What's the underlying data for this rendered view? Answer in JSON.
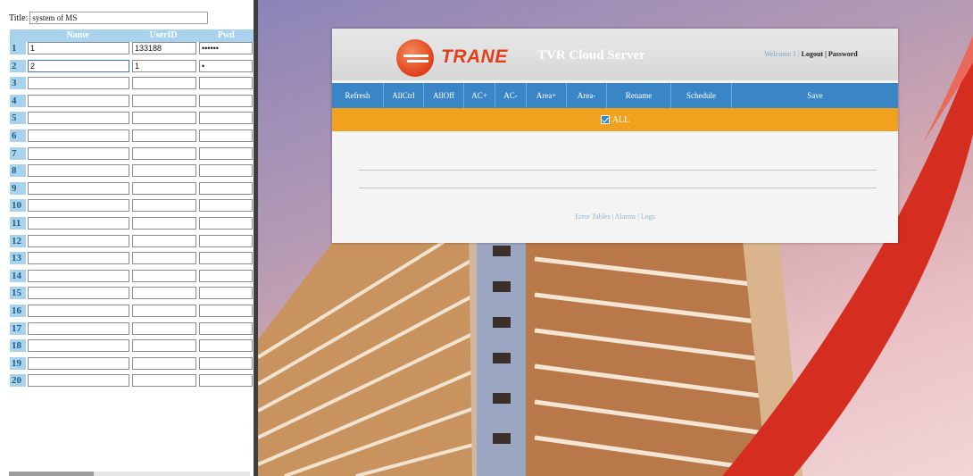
{
  "left": {
    "title_label": "Title:",
    "title_value": "system of MS",
    "headers": {
      "name": "Name",
      "userid": "UserID",
      "pwd": "Pwd"
    },
    "rows": [
      {
        "num": "1",
        "name": "1",
        "userid": "133188",
        "pwd": "••••••"
      },
      {
        "num": "2",
        "name": "2",
        "userid": "1",
        "pwd": "•"
      },
      {
        "num": "3",
        "name": "",
        "userid": "",
        "pwd": ""
      },
      {
        "num": "4",
        "name": "",
        "userid": "",
        "pwd": ""
      },
      {
        "num": "5",
        "name": "",
        "userid": "",
        "pwd": ""
      },
      {
        "num": "6",
        "name": "",
        "userid": "",
        "pwd": ""
      },
      {
        "num": "7",
        "name": "",
        "userid": "",
        "pwd": ""
      },
      {
        "num": "8",
        "name": "",
        "userid": "",
        "pwd": ""
      },
      {
        "num": "9",
        "name": "",
        "userid": "",
        "pwd": ""
      },
      {
        "num": "10",
        "name": "",
        "userid": "",
        "pwd": ""
      },
      {
        "num": "11",
        "name": "",
        "userid": "",
        "pwd": ""
      },
      {
        "num": "12",
        "name": "",
        "userid": "",
        "pwd": ""
      },
      {
        "num": "13",
        "name": "",
        "userid": "",
        "pwd": ""
      },
      {
        "num": "14",
        "name": "",
        "userid": "",
        "pwd": ""
      },
      {
        "num": "15",
        "name": "",
        "userid": "",
        "pwd": ""
      },
      {
        "num": "16",
        "name": "",
        "userid": "",
        "pwd": ""
      },
      {
        "num": "17",
        "name": "",
        "userid": "",
        "pwd": ""
      },
      {
        "num": "18",
        "name": "",
        "userid": "",
        "pwd": ""
      },
      {
        "num": "19",
        "name": "",
        "userid": "",
        "pwd": ""
      },
      {
        "num": "20",
        "name": "",
        "userid": "",
        "pwd": ""
      }
    ]
  },
  "app": {
    "logo_text": "TRANE",
    "server_name": "TVR Cloud Server",
    "welcome": "Welcome 1 |",
    "logout": "Logout",
    "sep": "|",
    "password": "Password",
    "nav": [
      "Refresh",
      "AllCtrl",
      "AllOff",
      "AC+",
      "AC-",
      "Area+",
      "Area-",
      "Rename",
      "Schedule",
      "Save"
    ],
    "all_label": "ALL",
    "footer": "Error Tables | Alarms | Logs"
  },
  "colors": {
    "accent_blue": "#3a85c6",
    "accent_orange": "#f2a11e",
    "brand_red": "#e0401a",
    "grid_header": "#a9d3ec"
  }
}
